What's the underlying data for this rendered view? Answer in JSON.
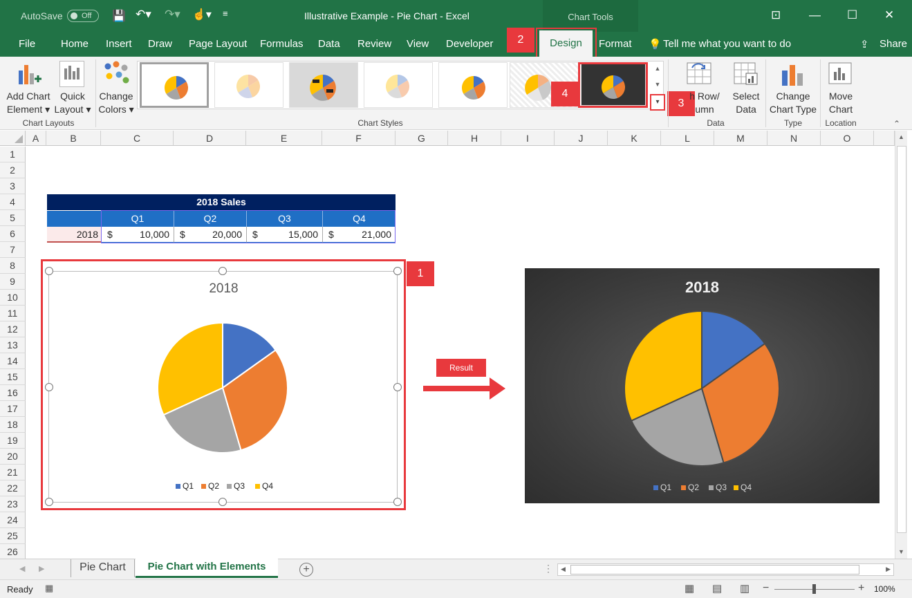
{
  "titlebar": {
    "autosave_label": "AutoSave",
    "autosave_state": "Off",
    "title": "Illustrative Example - Pie Chart  -  Excel",
    "context_tab_group": "Chart Tools"
  },
  "tabs": [
    "File",
    "Home",
    "Insert",
    "Draw",
    "Page Layout",
    "Formulas",
    "Data",
    "Review",
    "View",
    "Developer"
  ],
  "active_tab": "Design",
  "format_tab": "Format",
  "tell_me": "Tell me what you want to do",
  "share": "Share",
  "ribbon": {
    "add_chart_element": [
      "Add Chart",
      "Element ▾"
    ],
    "quick_layout": [
      "Quick",
      "Layout ▾"
    ],
    "change_colors": [
      "Change",
      "Colors ▾"
    ],
    "switch_row_col": [
      "h Row/",
      "umn"
    ],
    "select_data": [
      "Select",
      "Data"
    ],
    "change_chart_type": [
      "Change",
      "Chart Type"
    ],
    "move_chart": [
      "Move",
      "Chart"
    ],
    "groups": {
      "chart_layouts": "Chart Layouts",
      "chart_styles": "Chart Styles",
      "data": "Data",
      "type": "Type",
      "location": "Location"
    }
  },
  "columns": [
    "A",
    "B",
    "C",
    "D",
    "E",
    "F",
    "G",
    "H",
    "I",
    "J",
    "K",
    "L",
    "M",
    "N",
    "O"
  ],
  "rows": [
    "1",
    "2",
    "3",
    "4",
    "5",
    "6",
    "7",
    "8",
    "9",
    "10",
    "11",
    "12",
    "13",
    "14",
    "15",
    "16",
    "17",
    "18",
    "19",
    "20",
    "21",
    "22",
    "23",
    "24",
    "25",
    "26"
  ],
  "table": {
    "title": "2018 Sales",
    "headers": [
      "Q1",
      "Q2",
      "Q3",
      "Q4"
    ],
    "row_label": "2018",
    "currency": "$",
    "values": [
      "10,000",
      "20,000",
      "15,000",
      "21,000"
    ]
  },
  "badges": {
    "b1": "1",
    "b2": "2",
    "b3": "3",
    "b4": "4"
  },
  "result_label": "Result",
  "chart_data": [
    {
      "type": "pie",
      "title": "2018",
      "categories": [
        "Q1",
        "Q2",
        "Q3",
        "Q4"
      ],
      "values": [
        10000,
        20000,
        15000,
        21000
      ],
      "colors": [
        "#4472c4",
        "#ed7d31",
        "#a5a5a5",
        "#ffc000"
      ],
      "legend": "bottom",
      "style": "default"
    },
    {
      "type": "pie",
      "title": "2018",
      "categories": [
        "Q1",
        "Q2",
        "Q3",
        "Q4"
      ],
      "values": [
        10000,
        20000,
        15000,
        21000
      ],
      "colors": [
        "#4472c4",
        "#ed7d31",
        "#a5a5a5",
        "#ffc000"
      ],
      "legend": "bottom",
      "style": "dark"
    }
  ],
  "sheet_tabs": [
    "Pie Chart",
    "Pie Chart with Elements"
  ],
  "active_sheet": "Pie Chart with Elements",
  "status": {
    "ready": "Ready",
    "zoom": "100%"
  }
}
